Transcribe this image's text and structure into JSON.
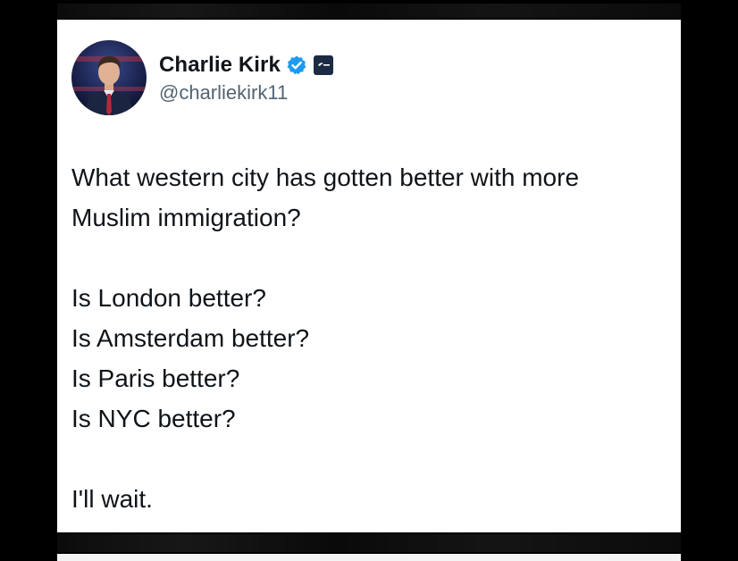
{
  "tweet": {
    "author": {
      "display_name": "Charlie Kirk",
      "handle": "@charliekirk11",
      "verified_icon": "verified-badge-icon",
      "affiliation_icon": "organization-badge-icon"
    },
    "text_lines": [
      "What western city has gotten better with more",
      "Muslim immigration?",
      "Is London better?",
      "Is Amsterdam better?",
      "Is Paris better?",
      "Is NYC better?",
      "I'll wait."
    ]
  },
  "colors": {
    "background": "#000000",
    "card": "#ffffff",
    "text_primary": "#0f1419",
    "text_secondary": "#536471",
    "verified_blue": "#1d9bf0",
    "org_badge": "#1c2a44"
  }
}
